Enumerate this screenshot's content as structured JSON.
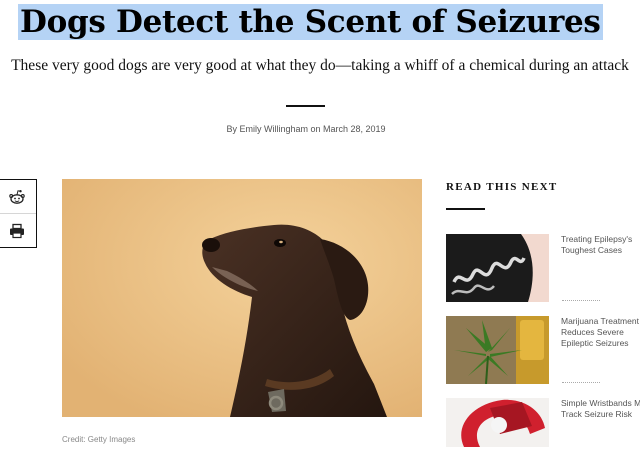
{
  "article": {
    "headline": "Dogs Detect the Scent of Seizures",
    "dek": "These very good dogs are very good at what they do—taking a whiff of a chemical during an attack",
    "byline": "By Emily Willingham on March 28, 2019",
    "image_credit": "Credit: Getty Images",
    "image_subject": "brown dog looking up against tan background"
  },
  "share": {
    "icons": [
      "reddit-icon",
      "print-icon"
    ]
  },
  "read_next": {
    "title": "READ THIS NEXT",
    "items": [
      {
        "text": "Treating Epilepsy's Toughest Cases",
        "thumb": "brain-scan"
      },
      {
        "text": "Marijuana Treatment Reduces Severe Epileptic Seizures",
        "thumb": "cannabis-leaf"
      },
      {
        "text": "Simple Wristbands May Track Seizure Risk",
        "thumb": "wristband"
      }
    ]
  },
  "colors": {
    "selection_highlight": "#b5d3f5",
    "photo_background": "#e9bd7f",
    "text_primary": "#111111"
  }
}
